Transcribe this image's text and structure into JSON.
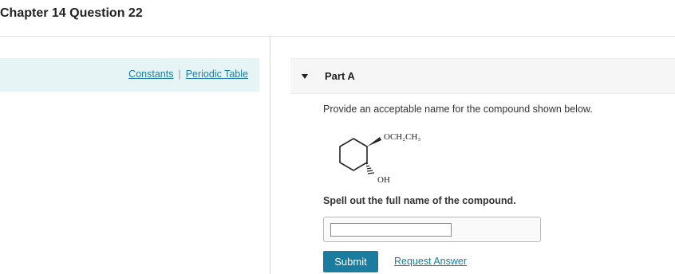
{
  "header": {
    "title": "Chapter 14 Question 22"
  },
  "resources": {
    "constants_label": "Constants",
    "separator": "|",
    "periodic_table_label": "Periodic Table"
  },
  "part": {
    "label": "Part A",
    "instruction": "Provide an acceptable name for the compound shown below.",
    "structure": {
      "substituent_top": "OCH₂CH₃",
      "substituent_bottom": "OH"
    },
    "prompt": "Spell out the full name of the compound.",
    "answer": {
      "value": "",
      "placeholder": ""
    },
    "submit_label": "Submit",
    "request_answer_label": "Request Answer"
  },
  "colors": {
    "accent": "#1a7da0",
    "left_panel_bg": "#e6f4f5",
    "part_header_bg": "#f6f6f6"
  }
}
